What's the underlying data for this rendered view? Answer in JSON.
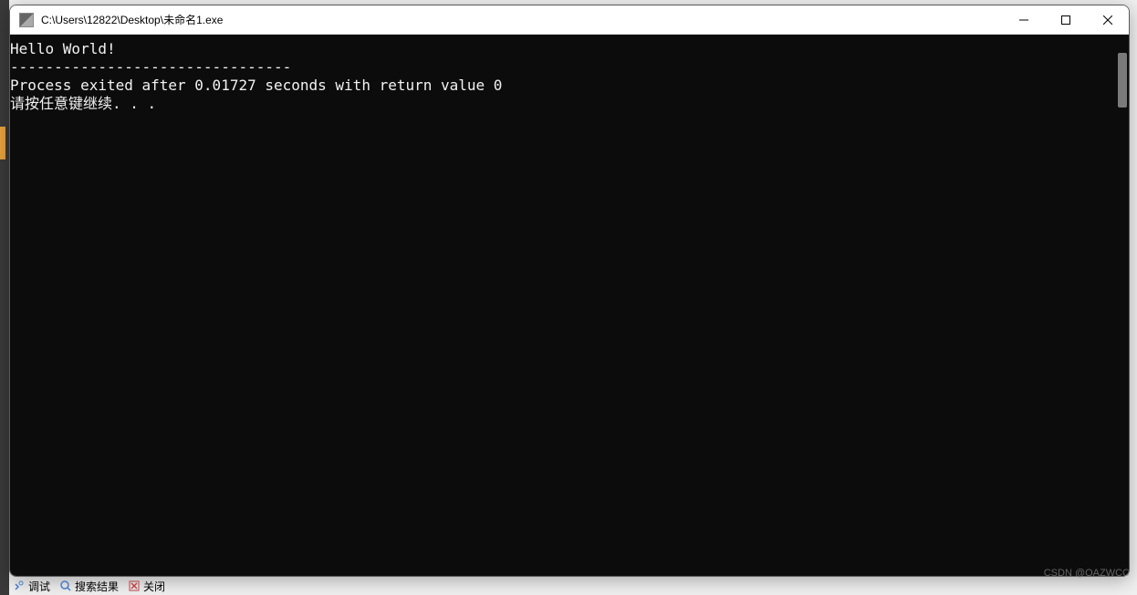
{
  "window": {
    "title": "C:\\Users\\12822\\Desktop\\未命名1.exe"
  },
  "console": {
    "line1": "Hello World!",
    "line2": "--------------------------------",
    "line3": "Process exited after 0.01727 seconds with return value 0",
    "line4": "请按任意键继续. . ."
  },
  "bottom_tabs": {
    "debug": "调试",
    "search": "搜索结果",
    "close": "关闭"
  },
  "watermark": "CSDN @OAZWCC"
}
